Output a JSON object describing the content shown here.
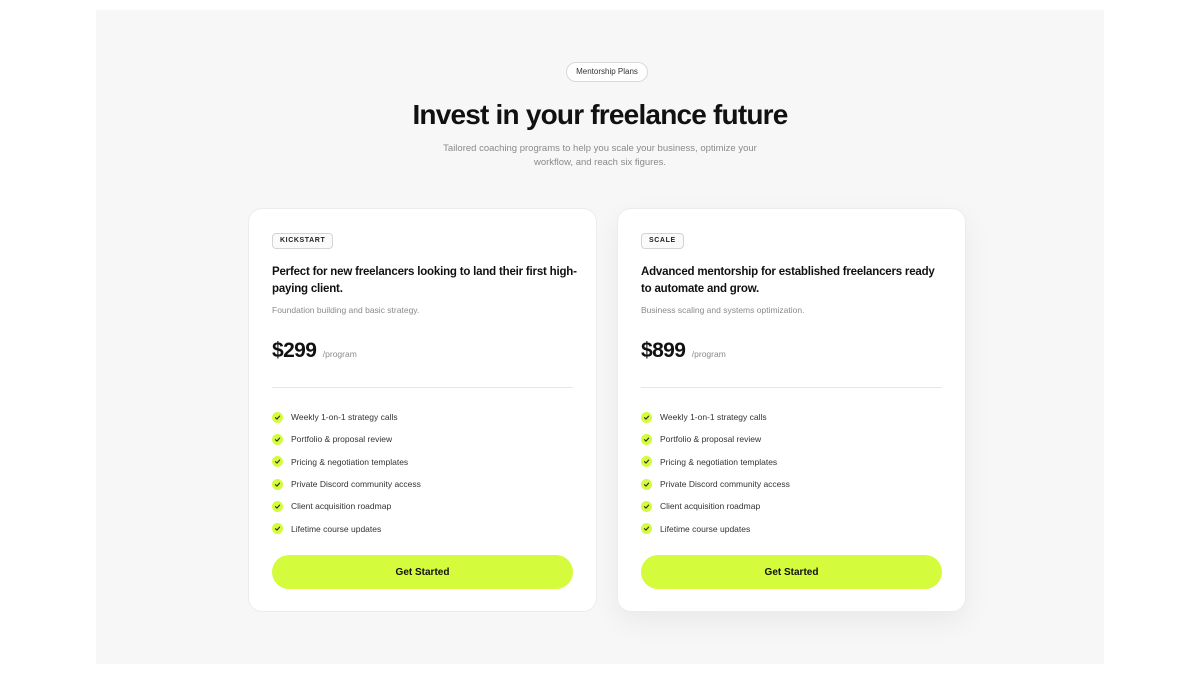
{
  "section": {
    "eyebrow": "Mentorship Plans",
    "title": "Invest in your freelance future",
    "subtitle": "Tailored coaching programs to help you scale your business, optimize your workflow, and reach six figures."
  },
  "colors": {
    "accent": "#d4fb3c",
    "background": "#f7f7f7",
    "card": "#ffffff",
    "text": "#111111",
    "muted": "#8a8a8a"
  },
  "plans": [
    {
      "badge": "KICKSTART",
      "tagline": "Perfect for new freelancers looking to land their first high-paying client.",
      "description": "Foundation building and basic strategy.",
      "price": "$299",
      "period": "/program",
      "features": [
        {
          "icon": "check-icon",
          "label": "Weekly 1-on-1 strategy calls"
        },
        {
          "icon": "check-icon",
          "label": "Portfolio & proposal review"
        },
        {
          "icon": "check-icon",
          "label": "Pricing & negotiation templates"
        },
        {
          "icon": "check-icon",
          "label": "Private Discord community access"
        },
        {
          "icon": "check-icon",
          "label": "Client acquisition roadmap"
        },
        {
          "icon": "check-icon",
          "label": "Lifetime course updates"
        }
      ],
      "cta_label": "Get Started"
    },
    {
      "badge": "SCALE",
      "tagline": "Advanced mentorship for established freelancers ready to automate and grow.",
      "description": "Business scaling and systems optimization.",
      "price": "$899",
      "period": "/program",
      "features": [
        {
          "icon": "check-icon",
          "label": "Weekly 1-on-1 strategy calls"
        },
        {
          "icon": "check-icon",
          "label": "Portfolio & proposal review"
        },
        {
          "icon": "check-icon",
          "label": "Pricing & negotiation templates"
        },
        {
          "icon": "check-icon",
          "label": "Private Discord community access"
        },
        {
          "icon": "check-icon",
          "label": "Client acquisition roadmap"
        },
        {
          "icon": "check-icon",
          "label": "Lifetime course updates"
        }
      ],
      "cta_label": "Get Started"
    }
  ]
}
